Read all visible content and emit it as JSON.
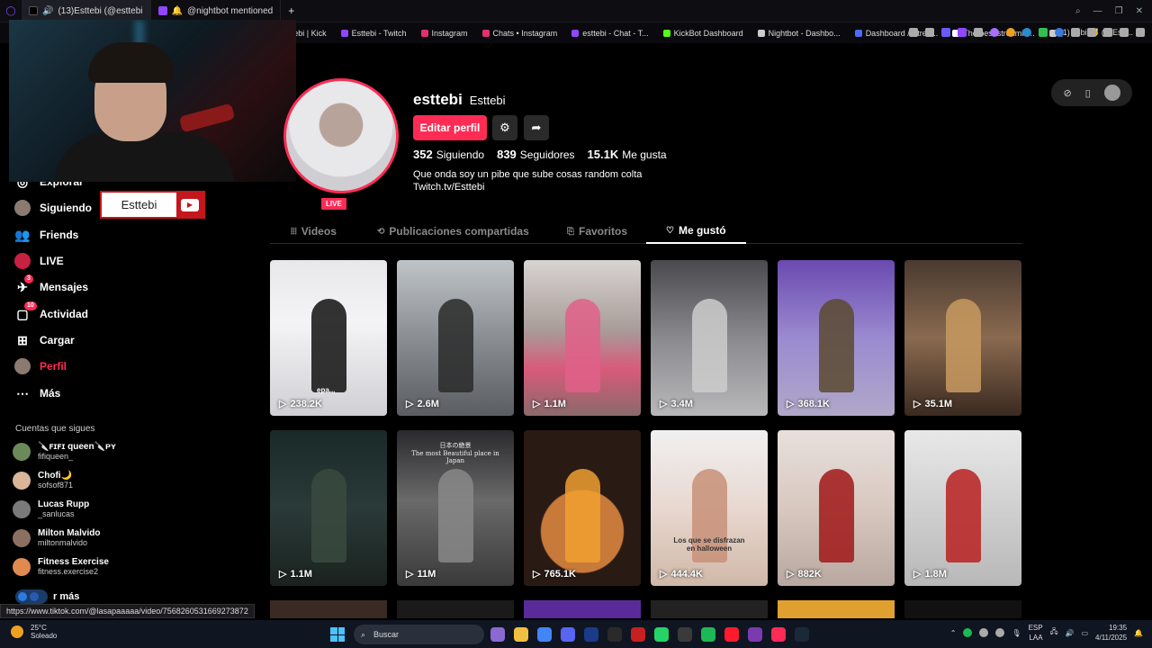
{
  "browser": {
    "tabs": [
      {
        "label": "(13)Esttebi (@esttebi",
        "color": "#fe2c55",
        "active": true
      },
      {
        "label": "@nightbot mentioned",
        "color": "#9146ff",
        "active": false
      }
    ],
    "new_tab": "+",
    "bookmarks": [
      {
        "label": "ttebi | Kick",
        "color": "#53fc18"
      },
      {
        "label": "Esttebi - Twitch",
        "color": "#9146ff"
      },
      {
        "label": "Instagram",
        "color": "#e1306c"
      },
      {
        "label": "Chats • Instagram",
        "color": "#e1306c"
      },
      {
        "label": "esttebi - Chat - T...",
        "color": "#9146ff"
      },
      {
        "label": "KickBot Dashboard",
        "color": "#53fc18"
      },
      {
        "label": "Nightbot - Dashbo...",
        "color": "#cccccc"
      },
      {
        "label": "Dashboard / Strea...",
        "color": "#4a6cf7"
      },
      {
        "label": "The best streamin...",
        "color": "#ffffff"
      },
      {
        "label": "(1) Tebi 🐱 (@Estt...",
        "color": "#cccccc"
      }
    ]
  },
  "sidebar": {
    "items": [
      {
        "label": "Explorar",
        "icon": "compass-icon",
        "glyph": "◎",
        "top": 0
      },
      {
        "label": "Siguiendo",
        "icon": "following-avatar-icon",
        "glyph": "●"
      },
      {
        "label": "Friends",
        "icon": "friends-icon",
        "glyph": "👥"
      },
      {
        "label": "LIVE",
        "icon": "live-icon",
        "glyph": "●"
      },
      {
        "label": "Mensajes",
        "icon": "messages-icon",
        "glyph": "✈",
        "badge": "3"
      },
      {
        "label": "Actividad",
        "icon": "activity-icon",
        "glyph": "▢",
        "badge": "10"
      },
      {
        "label": "Cargar",
        "icon": "upload-icon",
        "glyph": "⊞"
      },
      {
        "label": "Perfil",
        "icon": "profile-avatar-icon",
        "glyph": "●",
        "active_color": "#fe2c55"
      },
      {
        "label": "Más",
        "icon": "more-icon",
        "glyph": "⋯"
      }
    ],
    "following_title": "Cuentas que sigues",
    "following": [
      {
        "name": "🔪ꜰɪꜰɪ queen🔪ᴘʏ",
        "handle": "fifiqueen_",
        "color": "#6a8a5a"
      },
      {
        "name": "Chofi🌙",
        "handle": "sofsof871",
        "color": "#d9b59a"
      },
      {
        "name": "Lucas Rupp",
        "handle": "_sanlucas",
        "color": "#7a7a7a"
      },
      {
        "name": "Milton Malvido",
        "handle": "miltonmalvido",
        "color": "#8a7060"
      },
      {
        "name": "Fitness Exercise",
        "handle": "fitness.exercise2",
        "color": "#e08a50"
      }
    ],
    "see_more": "Ver más",
    "see_more_visible": "r más"
  },
  "overlay": {
    "youtube_name": "Esttebi"
  },
  "profile": {
    "username": "esttebi",
    "display_name": "Esttebi",
    "live_label": "LIVE",
    "edit_button": "Editar perfil",
    "stats": [
      {
        "value": "352",
        "label": "Siguiendo"
      },
      {
        "value": "839",
        "label": "Seguidores"
      },
      {
        "value": "15.1K",
        "label": "Me gusta"
      }
    ],
    "bio_line1": "Que onda soy un pibe que sube cosas random colta",
    "bio_line2": "Twitch.tv/Esttebi"
  },
  "tabs": [
    {
      "label": "Videos",
      "icon": "grid-icon",
      "glyph": "⦙⦙⦙"
    },
    {
      "label": "Publicaciones compartidas",
      "icon": "repost-icon",
      "glyph": "⟲"
    },
    {
      "label": "Favoritos",
      "icon": "bookmark-icon",
      "glyph": "⎘"
    },
    {
      "label": "Me gustó",
      "icon": "heart-icon",
      "glyph": "♡",
      "active": true
    }
  ],
  "videos": [
    {
      "views": "238.2K",
      "caption": "epa...",
      "bg": "linear-gradient(180deg,#e8e8ea 0%,#f4f4f6 40%,#d0d0d4 100%)",
      "subject": "#111"
    },
    {
      "views": "2.6M",
      "bg": "linear-gradient(180deg,#bfc4c8 0%,#8a8e92 50%,#5a5e62 100%)",
      "subject": "#2a2a2a"
    },
    {
      "views": "1.1M",
      "bg": "linear-gradient(180deg,#d8d4d2 0%,#a89c98 45%,#d85a7a 70%,#8a6a6a 100%)",
      "subject": "#e06088"
    },
    {
      "views": "3.4M",
      "bg": "linear-gradient(180deg,#4a4a4e 0%,#8a8a8e 50%,#b8b8ba 100%)",
      "subject": "#ccc"
    },
    {
      "views": "368.1K",
      "bg": "linear-gradient(180deg,#6a4ab0 0%,#9a8ad0 50%,#b0a8c8 100%)",
      "subject": "#5a4a30"
    },
    {
      "views": "35.1M",
      "bg": "linear-gradient(180deg,#4a3a30 0%,#8a6a50 50%,#3a2a20 100%)",
      "subject": "#c89a60"
    },
    {
      "views": "1.1M",
      "bg": "linear-gradient(180deg,#1a2a28 0%,#2a3a38 50%,#1a221e 100%)",
      "subject": "#3a4a40"
    },
    {
      "views": "11M",
      "subtitle": "日本の絶景\nThe most Beautiful place in\nJapan",
      "bg": "linear-gradient(180deg,#2a2a2e 0%,#6a6a6a 45%,#3a3a3a 100%)",
      "subject": "#888"
    },
    {
      "views": "765.1K",
      "bg": "radial-gradient(circle at 50% 65%,#c87a3a 0 35%,#2a1a14 36% 100%)",
      "subject": "#f0a030"
    },
    {
      "views": "444.4K",
      "caption": "Los que se disfrazan en halloween",
      "bg": "linear-gradient(180deg,#f0f0f0 0%,#e8d8d0 50%,#d0b8a8 100%)",
      "subject": "#c89078"
    },
    {
      "views": "882K",
      "bg": "linear-gradient(180deg,#e8e0dc 0%,#d8c8c0 50%,#b8a8a0 100%)",
      "subject": "#a01818"
    },
    {
      "views": "1.8M",
      "bg": "linear-gradient(180deg,#e8e8e8 0%,#d0d0d0 50%,#b8b8b8 100%)",
      "subject": "#b82020"
    }
  ],
  "status_url": "https://www.tiktok.com/@lasapaaaaa/video/7568260531669273872",
  "taskbar": {
    "temp": "25°C",
    "weather": "Soleado",
    "search": "Buscar",
    "lang1": "ESP",
    "lang2": "LAA",
    "time": "19:35",
    "date": "4/11/2025",
    "apps": [
      "#8a6ad0",
      "#f0c040",
      "#4285f4",
      "#5865f2",
      "#1a3a8a",
      "#2a2a2a",
      "#c82020",
      "#25d366",
      "#3a3a3a",
      "#1db954",
      "#ff1b2d",
      "#7a3ab0",
      "#fe2c55",
      "#1b2838"
    ]
  }
}
